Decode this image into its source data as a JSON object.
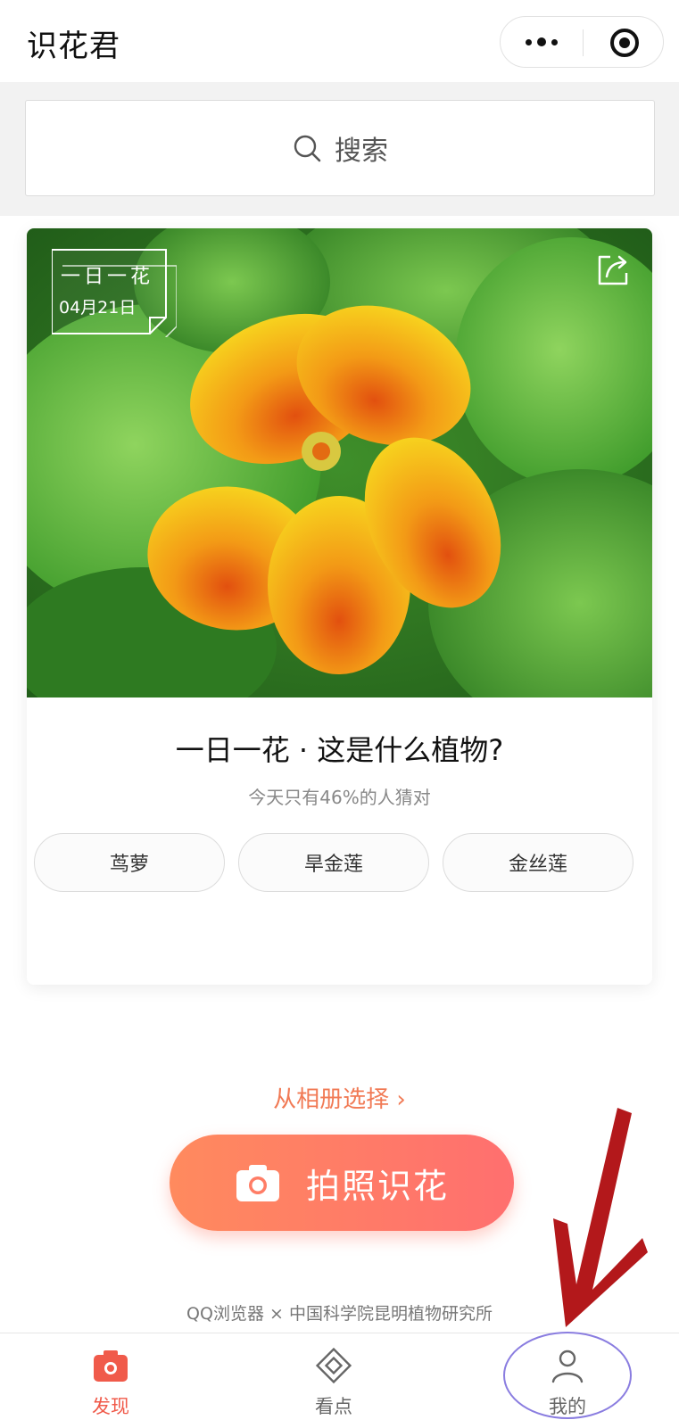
{
  "header": {
    "title": "识花君"
  },
  "search": {
    "label": "搜索"
  },
  "card": {
    "badge_line1": "一日一花",
    "badge_date": "04月21日",
    "quiz_title": "一日一花 · 这是什么植物?",
    "quiz_subtitle": "今天只有46%的人猜对",
    "options": [
      "茑萝",
      "旱金莲",
      "金丝莲"
    ]
  },
  "actions": {
    "album_link": "从相册选择",
    "photo_button": "拍照识花"
  },
  "footer": {
    "credit": "QQ浏览器 × 中国科学院昆明植物研究所"
  },
  "tabbar": {
    "tabs": [
      {
        "label": "发现",
        "icon": "camera-icon",
        "active": true
      },
      {
        "label": "看点",
        "icon": "diamond-icon",
        "active": false
      },
      {
        "label": "我的",
        "icon": "user-icon",
        "active": false
      }
    ]
  },
  "colors": {
    "accent": "#f05a4a",
    "button_gradient_start": "#ff8a5e",
    "button_gradient_end": "#ff6f6f",
    "link": "#f17a55",
    "annotation_arrow": "#b3181b",
    "annotation_circle": "#8a7de0"
  }
}
